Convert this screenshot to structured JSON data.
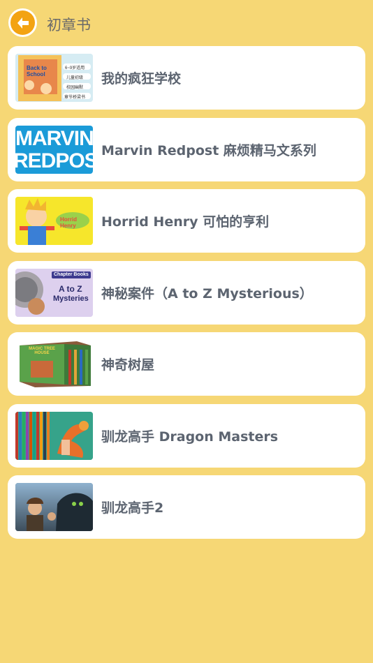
{
  "header": {
    "title": "初章书",
    "back_icon": "back-arrow-icon"
  },
  "colors": {
    "background": "#f6d775",
    "back_button": "#f3a312",
    "card_text": "#5c6470"
  },
  "books": [
    {
      "title": "我的疯狂学校",
      "cover_text": [
        "Back to School",
        "6~9岁适用",
        "儿童初级",
        "校园幽默",
        "章节桥梁书"
      ]
    },
    {
      "title": "Marvin Redpost  麻烦精马文系列",
      "cover_text": [
        "MARVIN",
        "REDPOST"
      ]
    },
    {
      "title": "Horrid Henry  可怕的亨利",
      "cover_text": [
        "Horrid Henry"
      ]
    },
    {
      "title": "神秘案件（A to Z Mysterious）",
      "cover_text": [
        "Chapter Books",
        "A to Z",
        "Mysteries"
      ]
    },
    {
      "title": "神奇树屋",
      "cover_text": [
        "MAGIC TREE HOUSE"
      ]
    },
    {
      "title": "驯龙高手 Dragon Masters",
      "cover_text": []
    },
    {
      "title": "驯龙高手2",
      "cover_text": []
    }
  ]
}
